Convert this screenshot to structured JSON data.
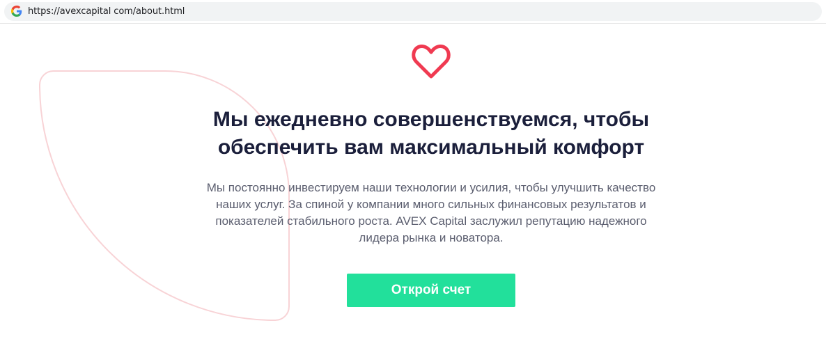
{
  "browser": {
    "url": "https://avexcapital com/about.html",
    "search_icon": "google-g-icon"
  },
  "hero": {
    "icon": "heart-icon",
    "accent_color": "#f03a51",
    "title_lines": [
      "Мы ежедневно совершенствуемся, чтобы",
      "обеспечить вам максимальный комфорт"
    ],
    "description_lines": [
      "Мы постоянно инвестируем наши технологии и усилия, чтобы улучшить качество",
      "наших услуг. За спиной у компании много сильных финансовых результатов и",
      "показателей стабильного роста. AVEX Capital заслужил репутацию надежного",
      "лидера рынка и новатора."
    ],
    "cta_label": "Открой счет",
    "cta_color": "#22e09b"
  }
}
